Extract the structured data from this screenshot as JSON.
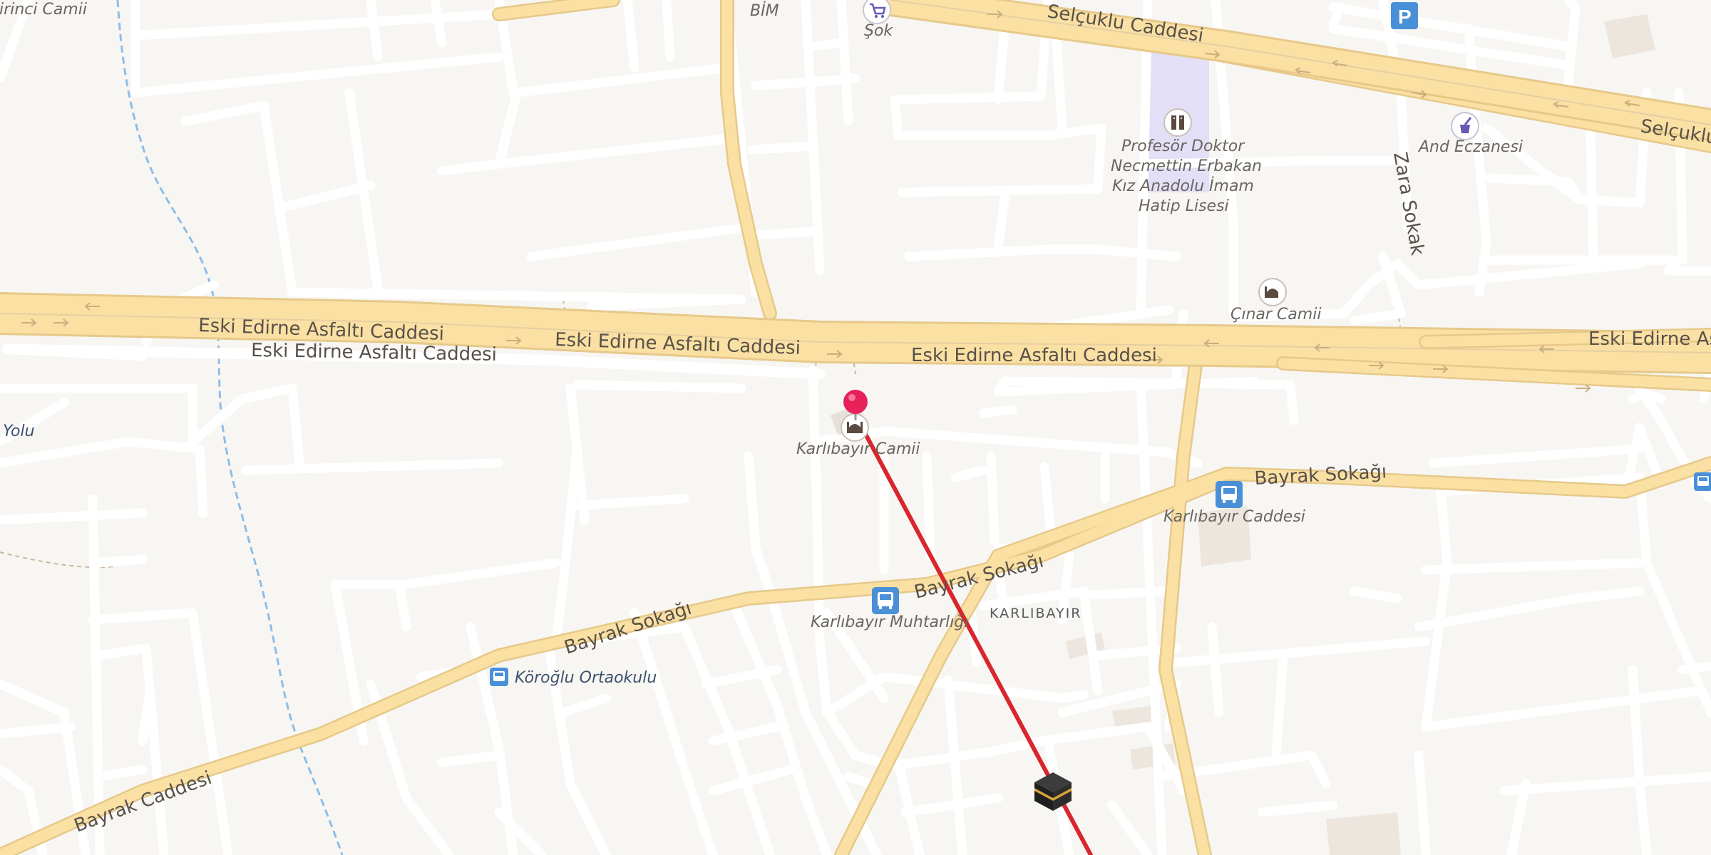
{
  "map": {
    "streets": {
      "selcuklu_1": "Selçuklu Caddesi",
      "selcuklu_2": "Selçuklu",
      "eski_edirne_1": "Eski Edirne Asfaltı Caddesi",
      "eski_edirne_2": "Eski Edirne Asfaltı Caddesi",
      "eski_edirne_3": "Eski Edirne Asfaltı Caddesi",
      "eski_edirne_service": "Eski Edirne Asfaltı Caddesi",
      "eski_edirne_4": "Eski Edirne Asf",
      "zara": "Zara Sokak",
      "bayrak_1": "Bayrak Sokağı",
      "bayrak_2": "Bayrak Sokağı",
      "bayrak_3": "Bayrak Sokağı",
      "bayrak_caddesi": "Bayrak Caddesi",
      "yolu": "Yolu"
    },
    "pois": {
      "birinci_camii": "ririnci Camii",
      "bim": "BİM",
      "sok": "Şok",
      "school_line1": "Profesör Doktor",
      "school_line2": "Necmettin Erbakan",
      "school_line3": "Kız Anadolu İmam",
      "school_line4": "Hatip Lisesi",
      "eczane": "And Eczanesi",
      "cinar_camii": "Çınar Camii",
      "karlibayir_camii": "Karlıbayır Camii",
      "karlibayir_muhtarligi": "Karlıbayır Muhtarlığı",
      "karlibayir_caddesi": "Karlıbayır Caddesi",
      "koroglu_ortaokulu": "Köroğlu Ortaokulu",
      "parking": "P"
    },
    "district": "KARLIBAYIR",
    "colors": {
      "background": "#f8f6f3",
      "main_road": "#fbe0a4",
      "road_casing": "#e6c98a",
      "minor_road": "#ffffff",
      "qibla_line": "#d9262e",
      "pin": "#e8215a",
      "bus_stop": "#4a90d9",
      "water": "#8ebde6",
      "school_area": "#e3dff6"
    },
    "icons": {
      "pin": "location-pin-icon",
      "mosque": "mosque-icon",
      "kaaba": "kaaba-icon",
      "bus": "bus-stop-icon",
      "shop": "shopping-cart-icon",
      "pharmacy": "pharmacy-icon",
      "school": "school-icon",
      "parking": "parking-icon"
    }
  }
}
